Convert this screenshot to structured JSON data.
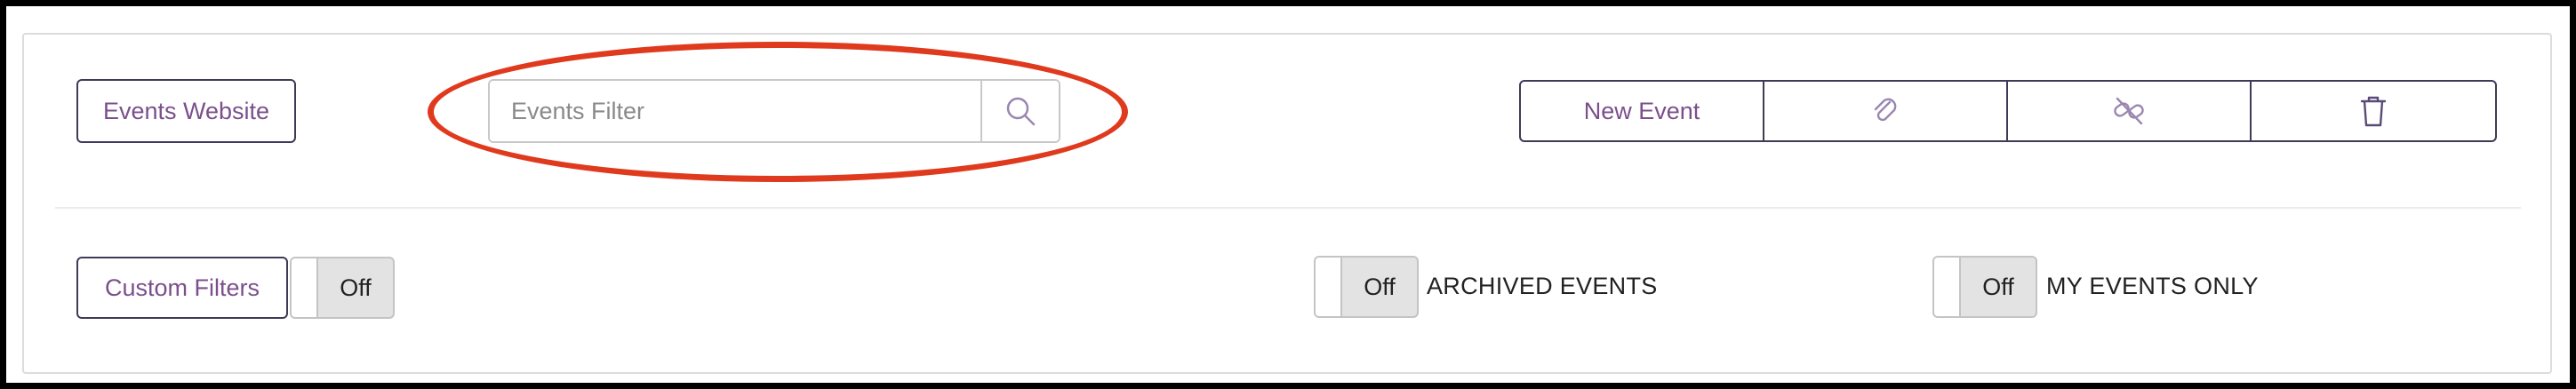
{
  "toolbar": {
    "events_website_label": "Events Website",
    "search": {
      "placeholder": "Events Filter",
      "value": ""
    },
    "new_event_label": "New Event",
    "icons": [
      "paperclip-icon",
      "unlink-icon",
      "trash-icon"
    ]
  },
  "filters": {
    "custom_filters_label": "Custom Filters",
    "custom_filters_state": "Off",
    "archived": {
      "state": "Off",
      "label": "ARCHIVED EVENTS"
    },
    "my_events": {
      "state": "Off",
      "label": "MY EVENTS ONLY"
    }
  },
  "colors": {
    "accent_text": "#7b4f8c",
    "border_dark": "#3f3a58",
    "highlight": "#e03a1e",
    "icon": "#9a86b0"
  }
}
